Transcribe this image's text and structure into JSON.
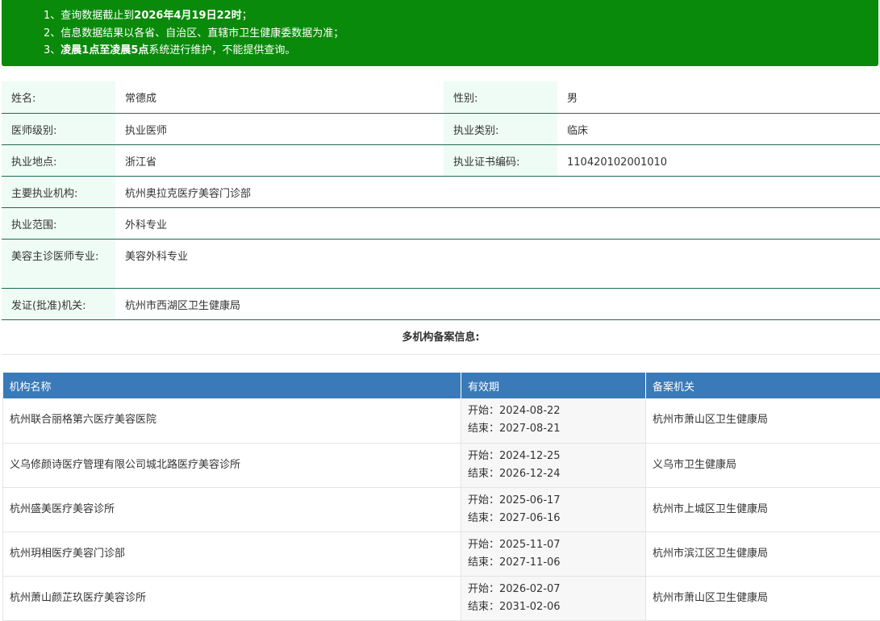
{
  "notice": {
    "line1_prefix": "1、查询数据截止到",
    "line1_bold": "2026年4月19日22时",
    "line1_suffix": "；",
    "line2": "2、信息数据结果以各省、自治区、直辖市卫生健康委数据为准；",
    "line3_prefix": "3、",
    "line3_bold": "凌晨1点至凌晨5点",
    "line3_suffix": "系统进行维护，不能提供查询。"
  },
  "info": {
    "name_label": "姓名:",
    "name": "常德成",
    "gender_label": "性别:",
    "gender": "男",
    "level_label": "医师级别:",
    "level": "执业医师",
    "category_label": "执业类别:",
    "category": "临床",
    "location_label": "执业地点:",
    "location": "浙江省",
    "cert_label": "执业证书编码:",
    "cert": "110420102001010",
    "org_label": "主要执业机构:",
    "org": "杭州奥拉克医疗美容门诊部",
    "scope_label": "执业范围:",
    "scope": "外科专业",
    "cosmetic_label": "美容主诊医师专业:",
    "cosmetic": "美容外科专业",
    "issuer_label": "发证(批准)机关:",
    "issuer": "杭州市西湖区卫生健康局"
  },
  "multi_title": "多机构备案信息:",
  "table": {
    "headers": [
      "机构名称",
      "有效期",
      "备案机关"
    ],
    "rows": [
      {
        "org": "杭州联合丽格第六医疗美容医院",
        "start": "开始：2024-08-22",
        "end": "结束：2027-08-21",
        "authority": "杭州市萧山区卫生健康局"
      },
      {
        "org": "义乌修颜诗医疗管理有限公司城北路医疗美容诊所",
        "start": "开始：2024-12-25",
        "end": "结束：2026-12-24",
        "authority": "义乌市卫生健康局"
      },
      {
        "org": "杭州盛美医疗美容诊所",
        "start": "开始：2025-06-17",
        "end": "结束：2027-06-16",
        "authority": "杭州市上城区卫生健康局"
      },
      {
        "org": "杭州玥相医疗美容门诊部",
        "start": "开始：2025-11-07",
        "end": "结束：2027-11-06",
        "authority": "杭州市滨江区卫生健康局"
      },
      {
        "org": "杭州萧山颜芷玖医疗美容诊所",
        "start": "开始：2026-02-07",
        "end": "结束：2031-02-06",
        "authority": "杭州市萧山区卫生健康局"
      }
    ]
  },
  "colors": {
    "notice_bg": "#0a8a0a",
    "header_bg": "#3a7ab8",
    "label_bg": "#effcf5"
  }
}
